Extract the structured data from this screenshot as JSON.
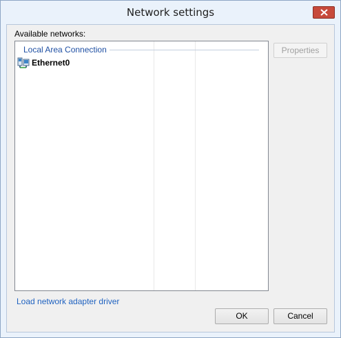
{
  "window": {
    "title": "Network settings"
  },
  "labels": {
    "available_networks": "Available networks:"
  },
  "network_list": {
    "group_header": "Local Area Connection",
    "items": [
      {
        "label": "Ethernet0",
        "icon": "network-adapter-icon"
      }
    ]
  },
  "buttons": {
    "properties": "Properties",
    "ok": "OK",
    "cancel": "Cancel"
  },
  "links": {
    "load_driver": "Load network adapter driver"
  },
  "colors": {
    "link": "#1f62c0",
    "group_header": "#1e4fa3",
    "close_button": "#c74a3a"
  }
}
